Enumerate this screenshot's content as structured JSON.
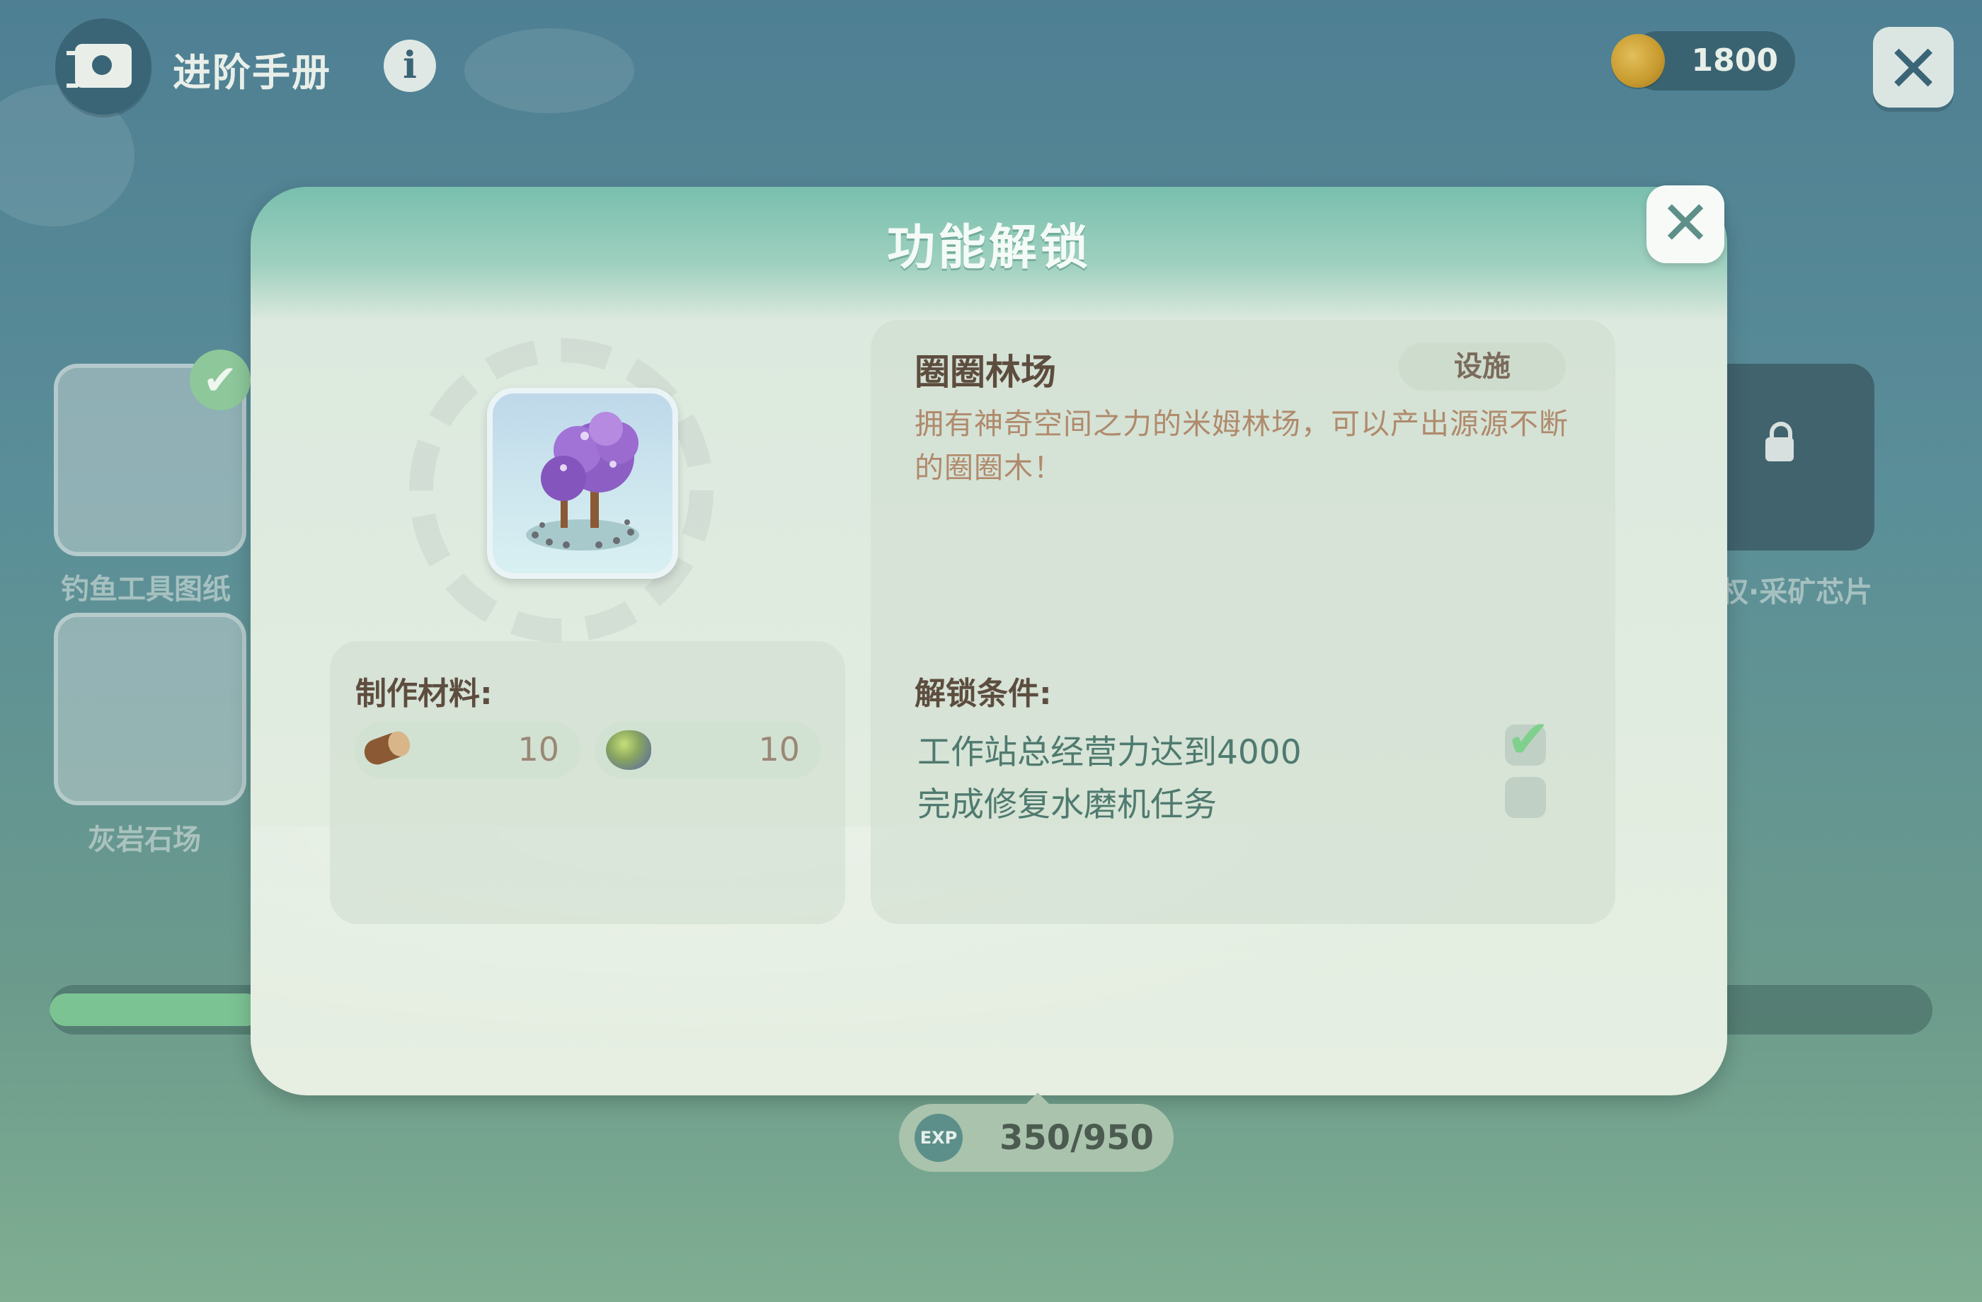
{
  "topbar": {
    "handbook_title": "进阶手册",
    "info_label": "i",
    "coins": "1800",
    "close_label": "✕"
  },
  "background_items": {
    "left_top_label": "钓鱼工具图纸",
    "left_bottom_label": "灰岩石场",
    "right_top_label": "权·采矿芯片"
  },
  "modal": {
    "title": "功能解锁",
    "close_label": "✕",
    "item": {
      "name": "圈圈林场",
      "category": "设施",
      "description": "拥有神奇空间之力的米姆林场，可以产出源源不断的圈圈木！"
    },
    "materials": {
      "label": "制作材料:",
      "items": [
        {
          "icon": "wood-log-icon",
          "qty": "10"
        },
        {
          "icon": "stone-ore-icon",
          "qty": "10"
        }
      ]
    },
    "conditions": {
      "label": "解锁条件:",
      "items": [
        {
          "text": "工作站总经营力达到4000",
          "done": true
        },
        {
          "text": "完成修复水磨机任务",
          "done": false
        }
      ]
    }
  },
  "exp": {
    "badge": "EXP",
    "value": "350/950"
  },
  "colors": {
    "header_teal": "#79bfae",
    "panel_bg": "#e6efe2",
    "check_green": "#7fd08c",
    "coin_gold": "#c79a2e"
  }
}
